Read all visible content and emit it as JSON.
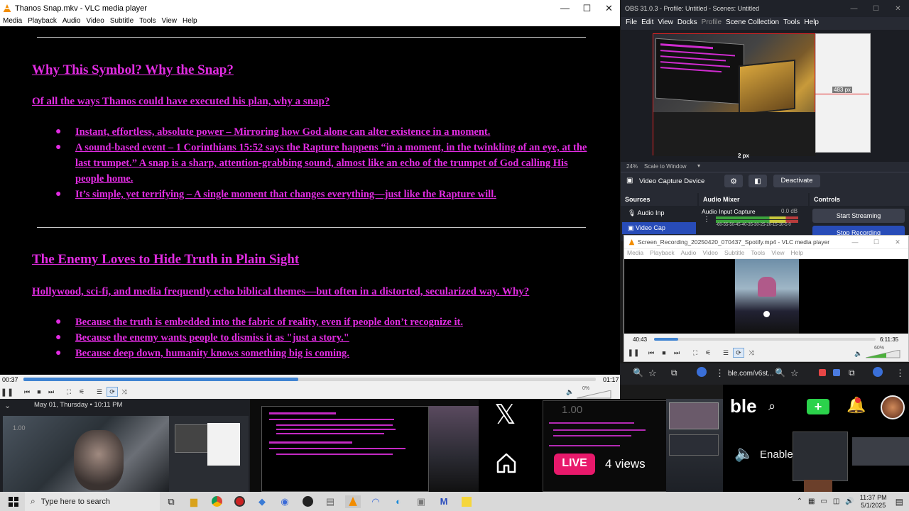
{
  "vlc_main": {
    "title": "Thanos Snap.mkv - VLC media player",
    "menu": [
      "Media",
      "Playback",
      "Audio",
      "Video",
      "Subtitle",
      "Tools",
      "View",
      "Help"
    ],
    "elapsed": "00:37",
    "total": "01:17",
    "progress": 0.48,
    "volume": "0%",
    "document": {
      "heading1": "Why This Symbol? Why the Snap?",
      "sub1": "Of all the ways Thanos could have executed his plan, why a snap?",
      "bullets1": [
        "Instant, effortless, absolute power – Mirroring how God alone can alter existence in a moment.",
        "A sound-based event – 1 Corinthians 15:52 says the Rapture happens “in a moment, in the twinkling of an eye, at the last trumpet.” A snap is a sharp, attention-grabbing sound, almost like an echo of the trumpet of God calling His people home.",
        "It’s simple, yet terrifying – A single moment that changes everything—just like the Rapture will."
      ],
      "heading2": "The Enemy Loves to Hide Truth in Plain Sight",
      "sub2": "Hollywood, sci-fi, and media frequently echo biblical themes—but often in a distorted, secularized way. Why?",
      "bullets2": [
        "Because the truth is embedded into the fabric of reality, even if people don’t recognize it.",
        "Because the enemy wants people to dismiss it as \"just a story.\"",
        "Because deep down, humanity knows something big is coming."
      ]
    }
  },
  "obs": {
    "title": "OBS 31.0.3 - Profile: Untitled - Scenes: Untitled",
    "menu": [
      "File",
      "Edit",
      "View",
      "Docks",
      "Profile",
      "Scene Collection",
      "Tools",
      "Help"
    ],
    "preview_label_right": "483 px",
    "preview_label_bottom": "2 px",
    "zoom": "24%",
    "scale_mode": "Scale to Window",
    "source_name": "Video Capture Device",
    "deactivate": "Deactivate",
    "docks": {
      "sources": "Sources",
      "mixer": "Audio Mixer",
      "controls": "Controls"
    },
    "sources_list": [
      "Audio Inp",
      "Video Cap"
    ],
    "mixer_track": "Audio Input Capture",
    "mixer_db": "0.0 dB",
    "mixer_scale": "-60-55-50-45-40-35-30-25-20-15-10-5 0",
    "start_streaming": "Start Streaming",
    "stop_recording": "Stop Recording",
    "colors": {
      "bg": "#272a33",
      "accent": "#284cb8"
    }
  },
  "vlc_secondary": {
    "title": "Screen_Recording_20250420_070437_Spotify.mp4 - VLC media player",
    "menu": [
      "Media",
      "Playback",
      "Audio",
      "Video",
      "Subtitle",
      "Tools",
      "View",
      "Help"
    ],
    "elapsed": "40:43",
    "total": "6:11:35",
    "progress": 0.11,
    "volume": "60%"
  },
  "lower": {
    "date_line": "May 01, Thursday • 10:11 PM",
    "left_thumb_label": "1.00",
    "mid_thumb_label": "1.00",
    "live_badge": "LIVE",
    "views": "4 views",
    "browser_url": "ble.com/v6st...",
    "brand_fragment": "ble",
    "enable_label": "Enable"
  },
  "taskbar": {
    "search_placeholder": "Type here to search",
    "time": "11:37 PM",
    "date": "5/1/2025"
  }
}
